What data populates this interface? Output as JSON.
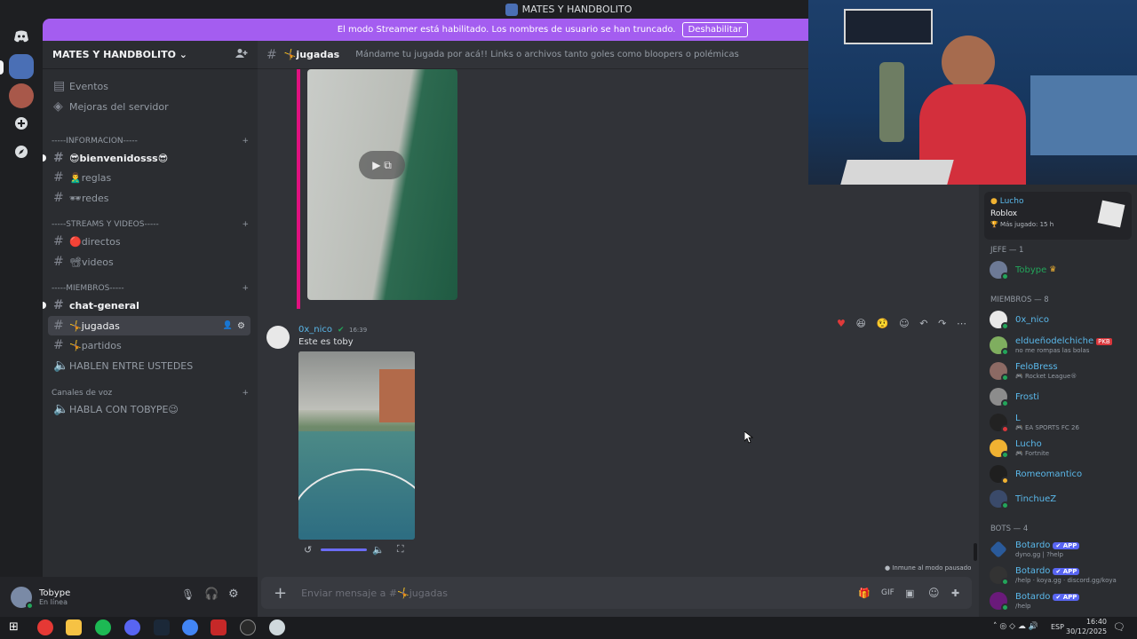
{
  "window": {
    "title": "MATES Y HANDBOLITO"
  },
  "banner": {
    "text": "El modo Streamer está habilitado. Los nombres de usuario se han truncado.",
    "button": "Deshabilitar"
  },
  "server": {
    "name": "MATES Y HANDBOLITO"
  },
  "sidebar": {
    "events": "Eventos",
    "boosts": "Mejoras del servidor",
    "categories": [
      "-----INFORMACION-----",
      "-----STREAMS Y VIDEOS-----",
      "-----MIEMBROS-----",
      "Canales de voz"
    ],
    "channels": [
      "😎bienvenidosss😎",
      "🙎‍♂️reglas",
      "🕶redes",
      "🔴directos",
      "📽videos",
      "chat-general",
      "🤸jugadas",
      "🤸partidos",
      "HABLEN ENTRE USTEDES",
      "HABLA CON TOBYPE😉"
    ]
  },
  "channel": {
    "name": "🤸jugadas",
    "topic": "Mándame tu jugada por acá!! Links o archivos tanto goles como bloopers o polémicas"
  },
  "message": {
    "author": "0x_nico",
    "time": "16:39",
    "text": "Este es toby"
  },
  "composer": {
    "placeholder": "Enviar mensaje a #🤸jugadas"
  },
  "paused_notice": "Inmune al modo pausado",
  "user": {
    "name": "Tobype",
    "status": "En línea"
  },
  "activity_card": {
    "user": "Lucho",
    "game": "Roblox",
    "detail": "Más jugado: 15 h"
  },
  "members": {
    "cat_jefe": "JEFE — 1",
    "cat_miembros": "MIEMBROS — 8",
    "cat_bots": "BOTS — 4",
    "jefe": [
      {
        "name": "Tobype",
        "color": "#23a55a"
      }
    ],
    "miembros": [
      {
        "name": "0x_nico",
        "sub": "",
        "color": "#5ab8ea"
      },
      {
        "name": "eldueñodelchiche",
        "sub": "no me rompas las bolas",
        "color": "#5ab8ea",
        "tag": "PKB"
      },
      {
        "name": "FeloBress",
        "sub": "Rocket League®",
        "color": "#5ab8ea"
      },
      {
        "name": "Frosti",
        "sub": "",
        "color": "#5ab8ea"
      },
      {
        "name": "L",
        "sub": "EA SPORTS FC 26",
        "color": "#5ab8ea"
      },
      {
        "name": "Lucho",
        "sub": "Fortnite",
        "color": "#5ab8ea"
      },
      {
        "name": "Romeomantico",
        "sub": "",
        "color": "#5ab8ea"
      },
      {
        "name": "TinchueZ",
        "sub": "",
        "color": "#5ab8ea"
      }
    ],
    "bots": [
      {
        "name": "Botardo",
        "sub": "dyno.gg | ?help",
        "tag": "APP"
      },
      {
        "name": "Botardo",
        "sub": "/help · koya.gg · discord.gg/koya",
        "tag": "APP"
      },
      {
        "name": "Botardo",
        "sub": "/help",
        "tag": "APP"
      }
    ]
  },
  "taskbar": {
    "lang": "ESP",
    "time": "16:40",
    "date": "30/12/2025"
  }
}
